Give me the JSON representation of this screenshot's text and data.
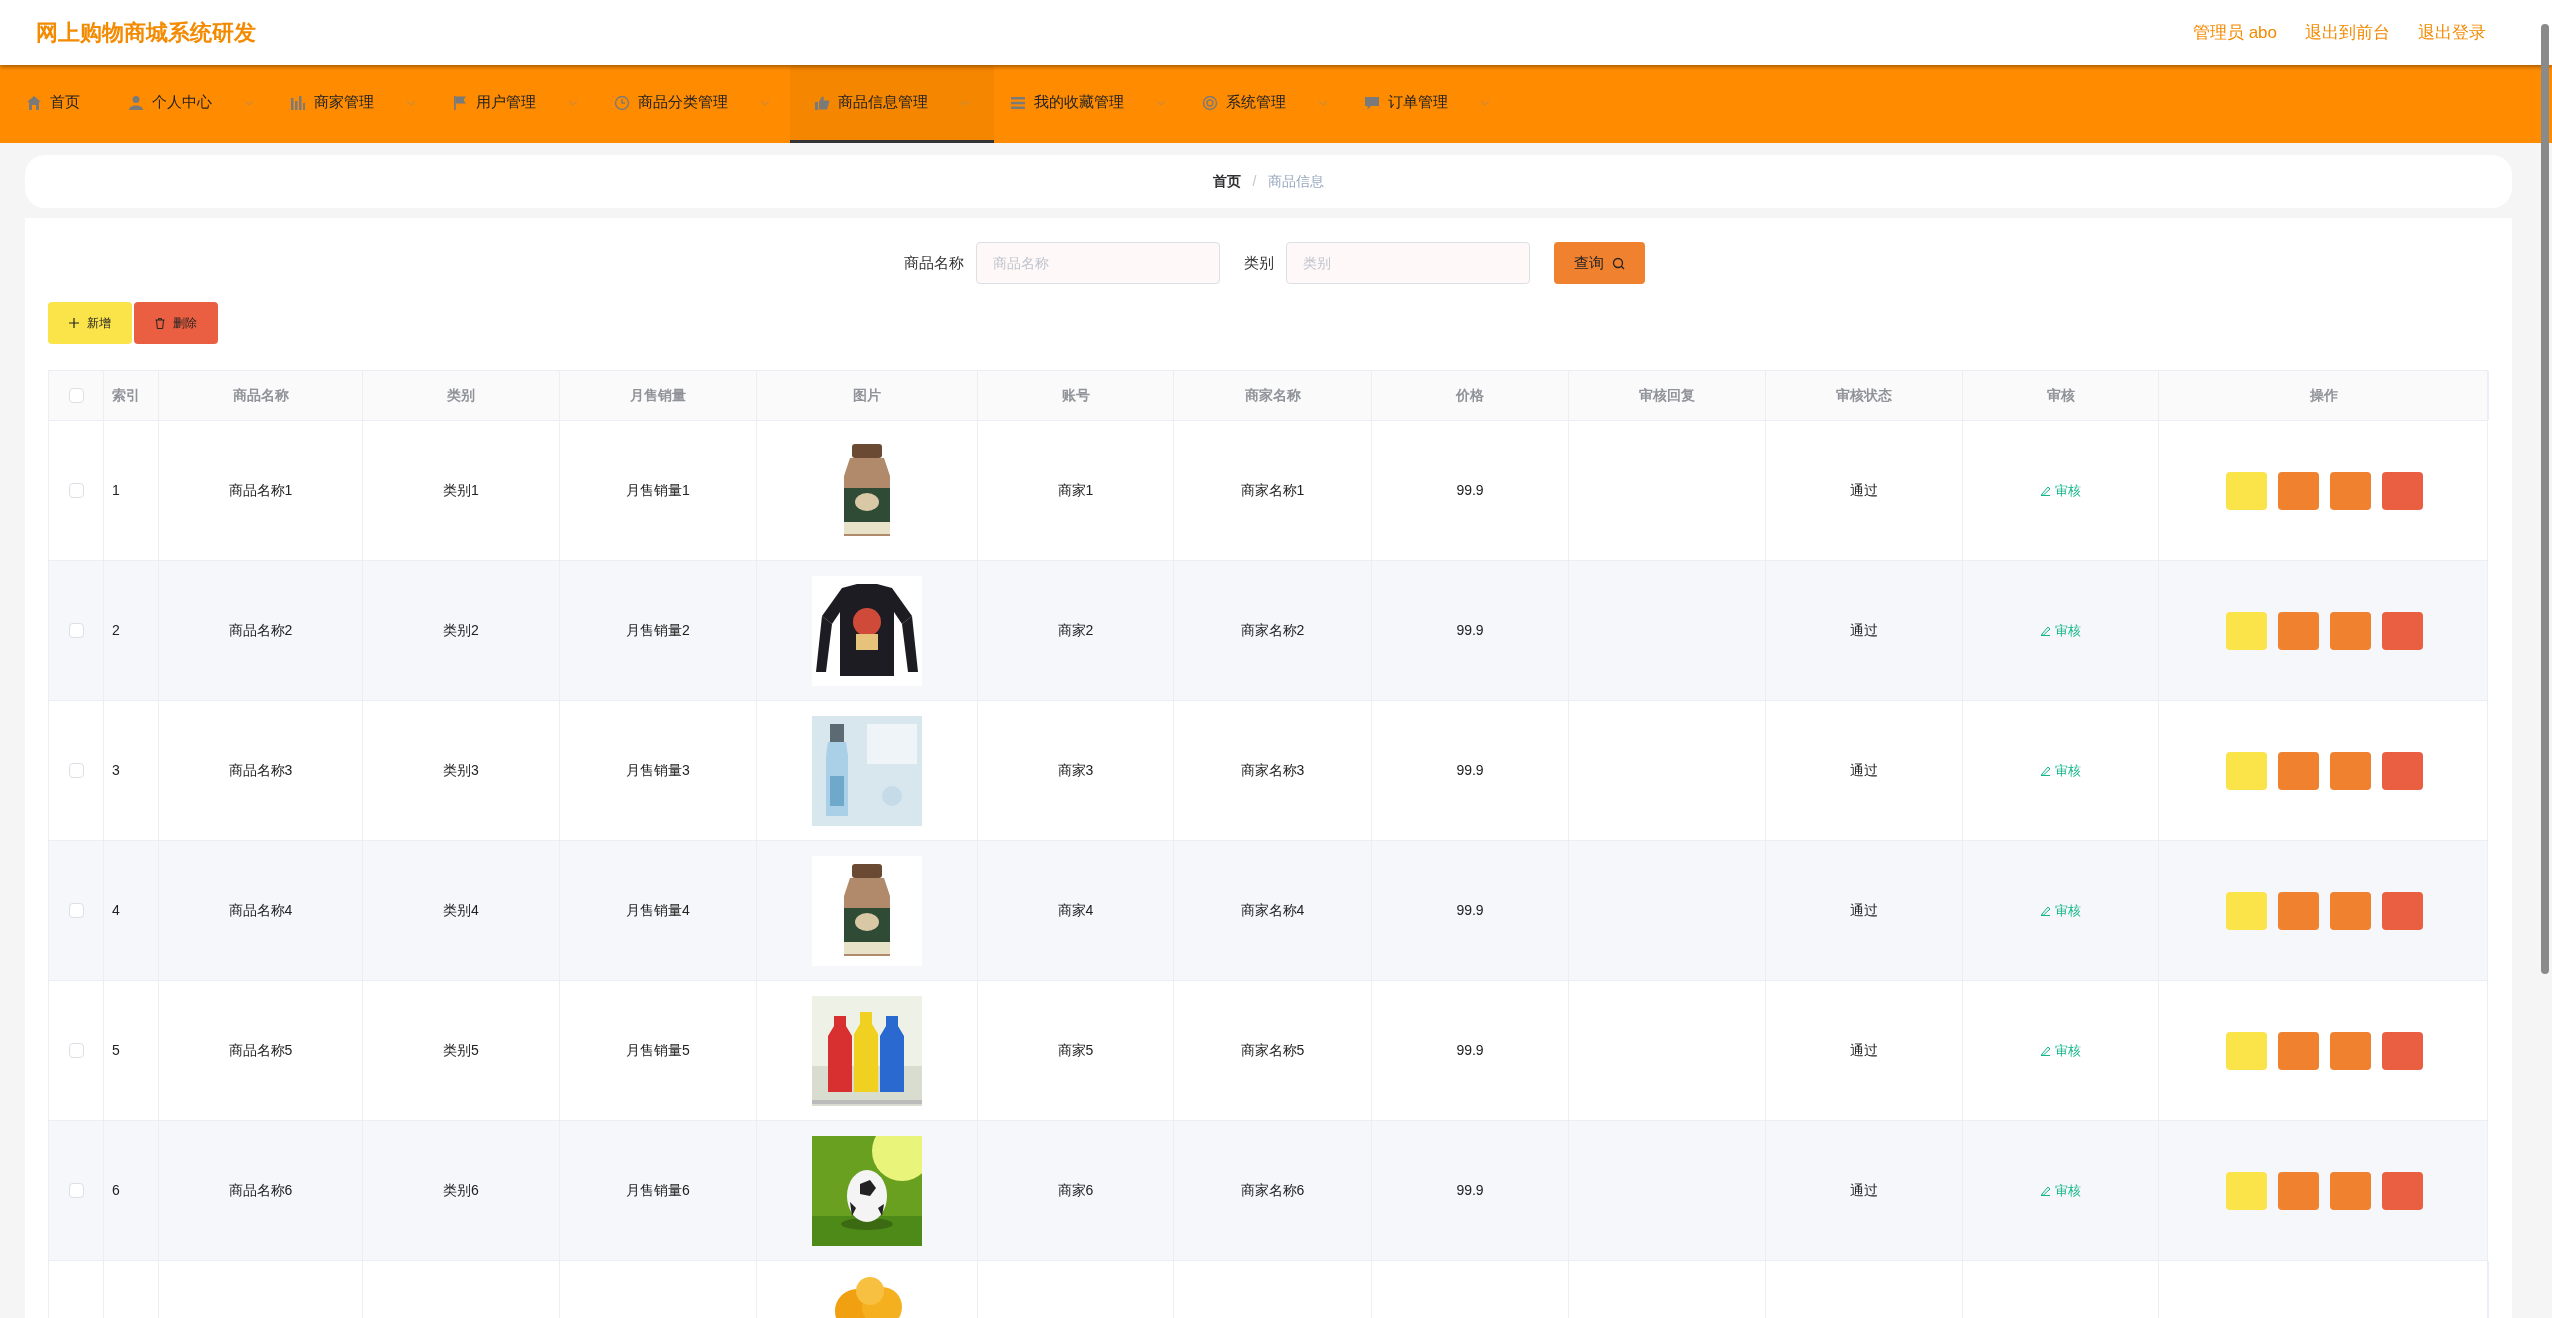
{
  "header": {
    "title": "网上购物商城系统研发",
    "links": [
      "管理员 abo",
      "退出到前台",
      "退出登录"
    ]
  },
  "nav": [
    {
      "label": "首页",
      "dropdown": false,
      "selected": false
    },
    {
      "label": "个人中心",
      "dropdown": true,
      "selected": false
    },
    {
      "label": "商家管理",
      "dropdown": true,
      "selected": false
    },
    {
      "label": "用户管理",
      "dropdown": true,
      "selected": false
    },
    {
      "label": "商品分类管理",
      "dropdown": true,
      "selected": false
    },
    {
      "label": "商品信息管理",
      "dropdown": true,
      "selected": true
    },
    {
      "label": "我的收藏管理",
      "dropdown": true,
      "selected": false
    },
    {
      "label": "系统管理",
      "dropdown": true,
      "selected": false
    },
    {
      "label": "订单管理",
      "dropdown": true,
      "selected": false
    }
  ],
  "breadcrumb": {
    "items": [
      "首页",
      "商品信息"
    ],
    "separator": "/"
  },
  "search": {
    "fields": [
      {
        "label": "商品名称",
        "placeholder": "商品名称"
      },
      {
        "label": "类别",
        "placeholder": "类别"
      }
    ],
    "button": "查询"
  },
  "toolbar": [
    {
      "label": "新增",
      "kind": "add"
    },
    {
      "label": "删除",
      "kind": "delete"
    }
  ],
  "table": {
    "select_all_checked": false,
    "columns": [
      "索引",
      "商品名称",
      "类别",
      "月售销量",
      "图片",
      "账号",
      "商家名称",
      "价格",
      "审核回复",
      "审核状态",
      "审核",
      "操作"
    ],
    "rows": [
      {
        "index": "1",
        "name": "商品名称1",
        "category": "类别1",
        "sales": "月售销量1",
        "account": "商家1",
        "shop": "商家名称1",
        "price": "99.9",
        "reply": "",
        "status": "通过",
        "audit": "审核",
        "checked": false
      },
      {
        "index": "2",
        "name": "商品名称2",
        "category": "类别2",
        "sales": "月售销量2",
        "account": "商家2",
        "shop": "商家名称2",
        "price": "99.9",
        "reply": "",
        "status": "通过",
        "audit": "审核",
        "checked": false
      },
      {
        "index": "3",
        "name": "商品名称3",
        "category": "类别3",
        "sales": "月售销量3",
        "account": "商家3",
        "shop": "商家名称3",
        "price": "99.9",
        "reply": "",
        "status": "通过",
        "audit": "审核",
        "checked": false
      },
      {
        "index": "4",
        "name": "商品名称4",
        "category": "类别4",
        "sales": "月售销量4",
        "account": "商家4",
        "shop": "商家名称4",
        "price": "99.9",
        "reply": "",
        "status": "通过",
        "audit": "审核",
        "checked": false
      },
      {
        "index": "5",
        "name": "商品名称5",
        "category": "类别5",
        "sales": "月售销量5",
        "account": "商家5",
        "shop": "商家名称5",
        "price": "99.9",
        "reply": "",
        "status": "通过",
        "audit": "审核",
        "checked": false
      },
      {
        "index": "6",
        "name": "商品名称6",
        "category": "类别6",
        "sales": "月售销量6",
        "account": "商家6",
        "shop": "商家名称6",
        "price": "99.9",
        "reply": "",
        "status": "通过",
        "audit": "审核",
        "checked": false
      }
    ]
  }
}
